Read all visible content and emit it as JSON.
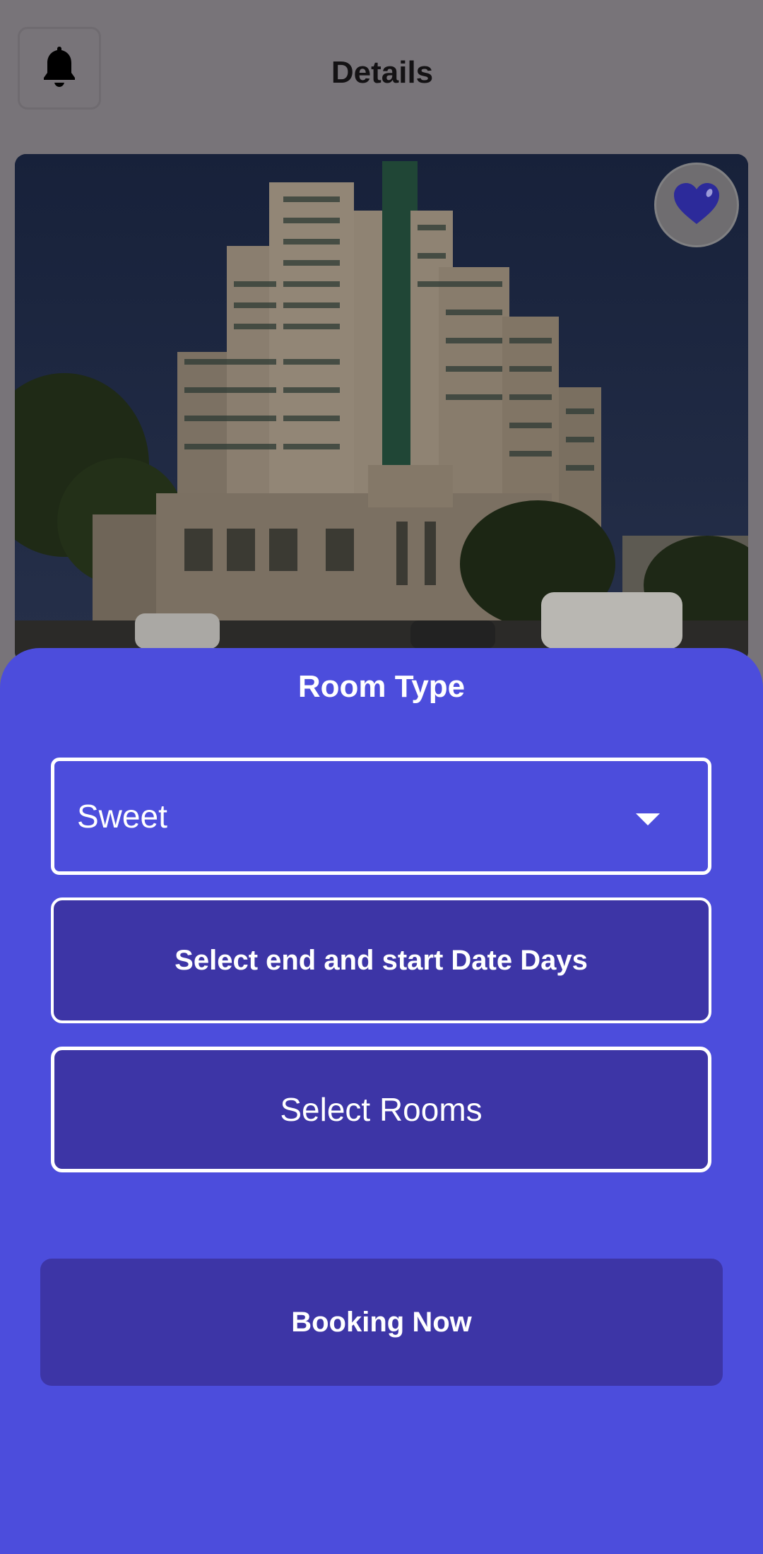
{
  "header": {
    "title": "Details",
    "notification_icon": "bell-icon"
  },
  "hero": {
    "favorite_icon": "heart-icon",
    "favorite_color": "#2c2a9a"
  },
  "booking_sheet": {
    "title": "Room Type",
    "room_type_selected": "Sweet",
    "date_button_label": "Select end and start Date Days",
    "rooms_button_label": "Select Rooms",
    "booking_button_label": "Booking Now"
  },
  "colors": {
    "accent": "#4c4ddc",
    "button_dark": "#3d35a6",
    "overlay": "#787479"
  }
}
